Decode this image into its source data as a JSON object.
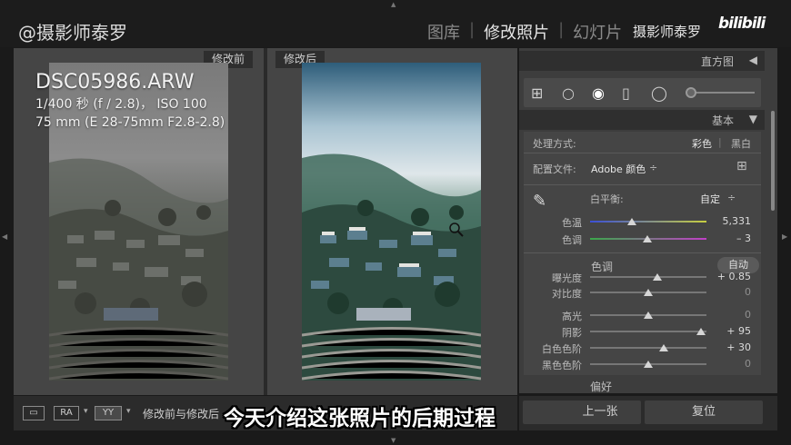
{
  "topbar": {
    "brand": "@摄影师泰罗",
    "modules": [
      "图库",
      "修改照片",
      "幻灯片"
    ],
    "active_module": "修改照片",
    "watermark": "摄影师泰罗",
    "bili_logo": "bilibili"
  },
  "compare": {
    "before_label": "修改前",
    "after_label": "修改后",
    "info": {
      "filename": "DSC05986.ARW",
      "exposure": "1/400 秒 (f / 2.8)， ISO 100",
      "lens": "75 mm (E 28-75mm F2.8-2.8)"
    }
  },
  "panel": {
    "histogram_label": "直方图",
    "basic_label": "基本",
    "treatment_label": "处理方式:",
    "treatment_color": "彩色",
    "treatment_bw": "黑白",
    "profile_label": "配置文件:",
    "profile_value": "Adobe 颜色",
    "wb_label": "白平衡:",
    "wb_value": "自定",
    "temp_label": "色温",
    "temp_value": "5,331",
    "tint_label": "色调",
    "tint_value": "– 3",
    "tone_label": "色调",
    "auto_label": "自动",
    "sliders": [
      {
        "label": "曝光度",
        "value": "+ 0.85",
        "pos": 0.58
      },
      {
        "label": "对比度",
        "value": "0",
        "pos": 0.5
      },
      {
        "label": "高光",
        "value": "0",
        "pos": 0.5
      },
      {
        "label": "阴影",
        "value": "+ 95",
        "pos": 0.95
      },
      {
        "label": "白色色阶",
        "value": "+ 30",
        "pos": 0.63
      },
      {
        "label": "黑色色阶",
        "value": "0",
        "pos": 0.5
      }
    ],
    "temp_pos": 0.36,
    "tint_pos": 0.49,
    "preset_label": "偏好"
  },
  "bottom": {
    "view_ra": "RA",
    "view_yy": "YY",
    "compare_label": "修改前与修改后",
    "prev_label": "上一张",
    "reset_label": "复位"
  },
  "subtitle": "今天介绍这张照片的后期过程"
}
